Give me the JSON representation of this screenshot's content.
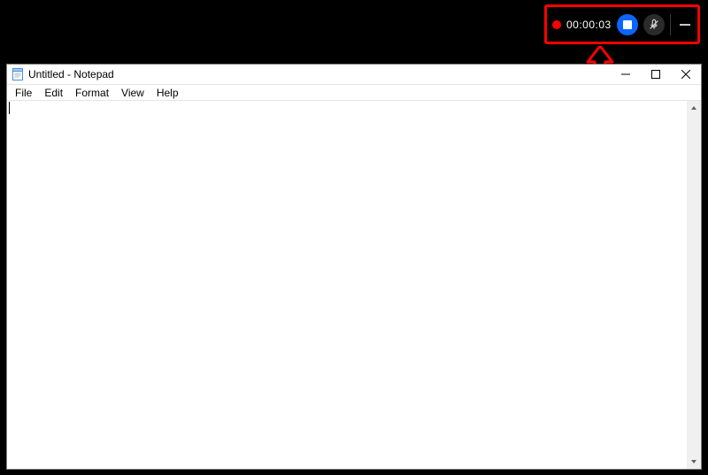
{
  "recording_bar": {
    "timer": "00:00:03",
    "recording": true,
    "mic_muted": true
  },
  "notepad": {
    "title": "Untitled - Notepad",
    "menu": {
      "file": "File",
      "edit": "Edit",
      "format": "Format",
      "view": "View",
      "help": "Help"
    },
    "content": ""
  },
  "annotation": {
    "highlight_color": "#ff0000"
  }
}
